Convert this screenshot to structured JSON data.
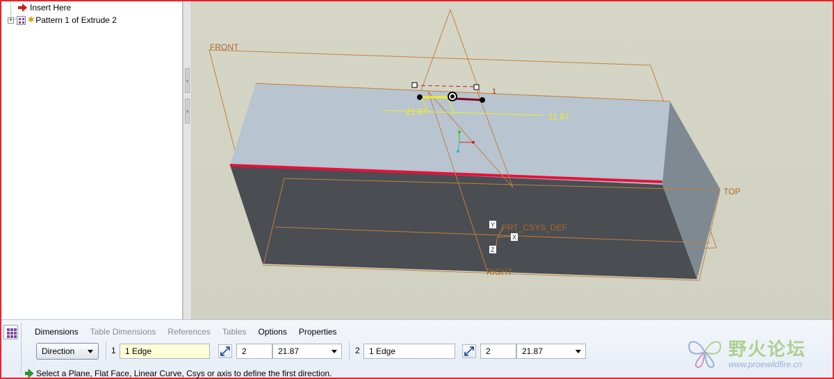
{
  "model_tree": {
    "items": [
      {
        "label": "Insert Here",
        "icon": "insert-here-arrow-icon"
      },
      {
        "label": "Pattern 1 of Extrude 2",
        "icon": "pattern-feature-icon"
      }
    ]
  },
  "viewport": {
    "datum_planes": {
      "front": "FRONT",
      "top": "TOP",
      "right": "RIGHT"
    },
    "csys_label": "PRT_CSYS_DEF",
    "csys_axes": {
      "x": "X",
      "y": "Y",
      "z": "Z"
    },
    "dimension_1": "21.87",
    "dimension_2": "21.87",
    "pattern_index": "1",
    "colors": {
      "background": "#d4d4c4",
      "top_face": "#b8c4d0",
      "front_face": "#4a4d52",
      "side_face": "#7f8991",
      "datum": "#c08040",
      "selected_edge": "#e8103a",
      "dimension": "#f0f020"
    }
  },
  "dashboard": {
    "tabs": [
      {
        "label": "Dimensions",
        "enabled": true
      },
      {
        "label": "Table Dimensions",
        "enabled": false
      },
      {
        "label": "References",
        "enabled": false
      },
      {
        "label": "Tables",
        "enabled": false
      },
      {
        "label": "Options",
        "enabled": true
      },
      {
        "label": "Properties",
        "enabled": true
      }
    ],
    "pattern_type": "Direction",
    "dir1": {
      "index": "1",
      "reference": "1 Edge",
      "count": "2",
      "spacing": "21.87"
    },
    "dir2": {
      "index": "2",
      "reference": "1 Edge",
      "count": "2",
      "spacing": "21.87"
    },
    "status_message": "Select a Plane, Flat Face, Linear Curve, Csys or axis to define the first direction."
  },
  "watermark": {
    "text": "野火论坛",
    "url": "www.proewildfire.cn"
  }
}
